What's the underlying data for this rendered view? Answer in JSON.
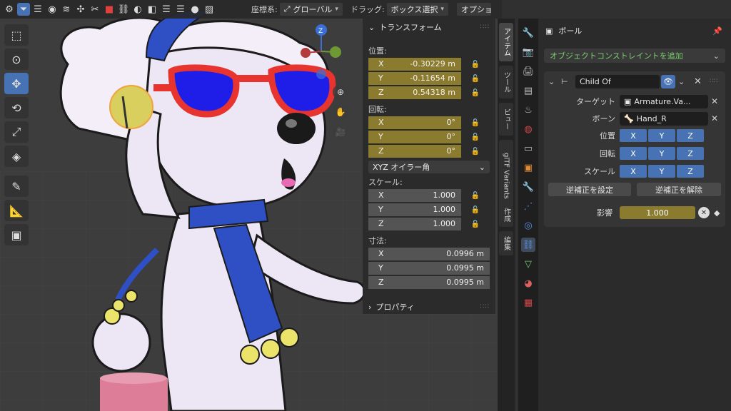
{
  "header": {
    "coord_label": "座標系:",
    "coord_value": "グローバル",
    "drag_label": "ドラッグ:",
    "drag_value": "ボックス選択",
    "options_label": "オプション"
  },
  "npanel": {
    "transform_title": "トランスフォーム",
    "location_label": "位置:",
    "location": [
      {
        "axis": "X",
        "value": "-0.30229 m"
      },
      {
        "axis": "Y",
        "value": "-0.11654 m"
      },
      {
        "axis": "Z",
        "value": "0.54318 m"
      }
    ],
    "rotation_label": "回転:",
    "rotation": [
      {
        "axis": "X",
        "value": "0°"
      },
      {
        "axis": "Y",
        "value": "0°"
      },
      {
        "axis": "Z",
        "value": "0°"
      }
    ],
    "rotation_mode": "XYZ オイラー角",
    "scale_label": "スケール:",
    "scale": [
      {
        "axis": "X",
        "value": "1.000"
      },
      {
        "axis": "Y",
        "value": "1.000"
      },
      {
        "axis": "Z",
        "value": "1.000"
      }
    ],
    "dimensions_label": "寸法:",
    "dimensions": [
      {
        "axis": "X",
        "value": "0.0996 m"
      },
      {
        "axis": "Y",
        "value": "0.0995 m"
      },
      {
        "axis": "Z",
        "value": "0.0995 m"
      }
    ],
    "properties_title": "プロパティ"
  },
  "vtabs": [
    "アイテム",
    "ツール",
    "ビュー",
    "glTF Variants",
    "作成",
    "編集"
  ],
  "props": {
    "object_name": "ボール",
    "add_constraint": "オブジェクトコンストレイントを追加",
    "constraint_name": "Child Of",
    "target_label": "ターゲット",
    "target_value": "Armature.Va...",
    "bone_label": "ボーン",
    "bone_value": "Hand_R",
    "location_label": "位置",
    "rotation_label": "回転",
    "scale_label": "スケール",
    "axis_x": "X",
    "axis_y": "Y",
    "axis_z": "Z",
    "set_inverse": "逆補正を設定",
    "clear_inverse": "逆補正を解除",
    "influence_label": "影響",
    "influence_value": "1.000"
  },
  "colors": {
    "active_blue": "#4772b3",
    "anim_yellow": "#8a7b2e",
    "add_green": "#7ad06e"
  }
}
